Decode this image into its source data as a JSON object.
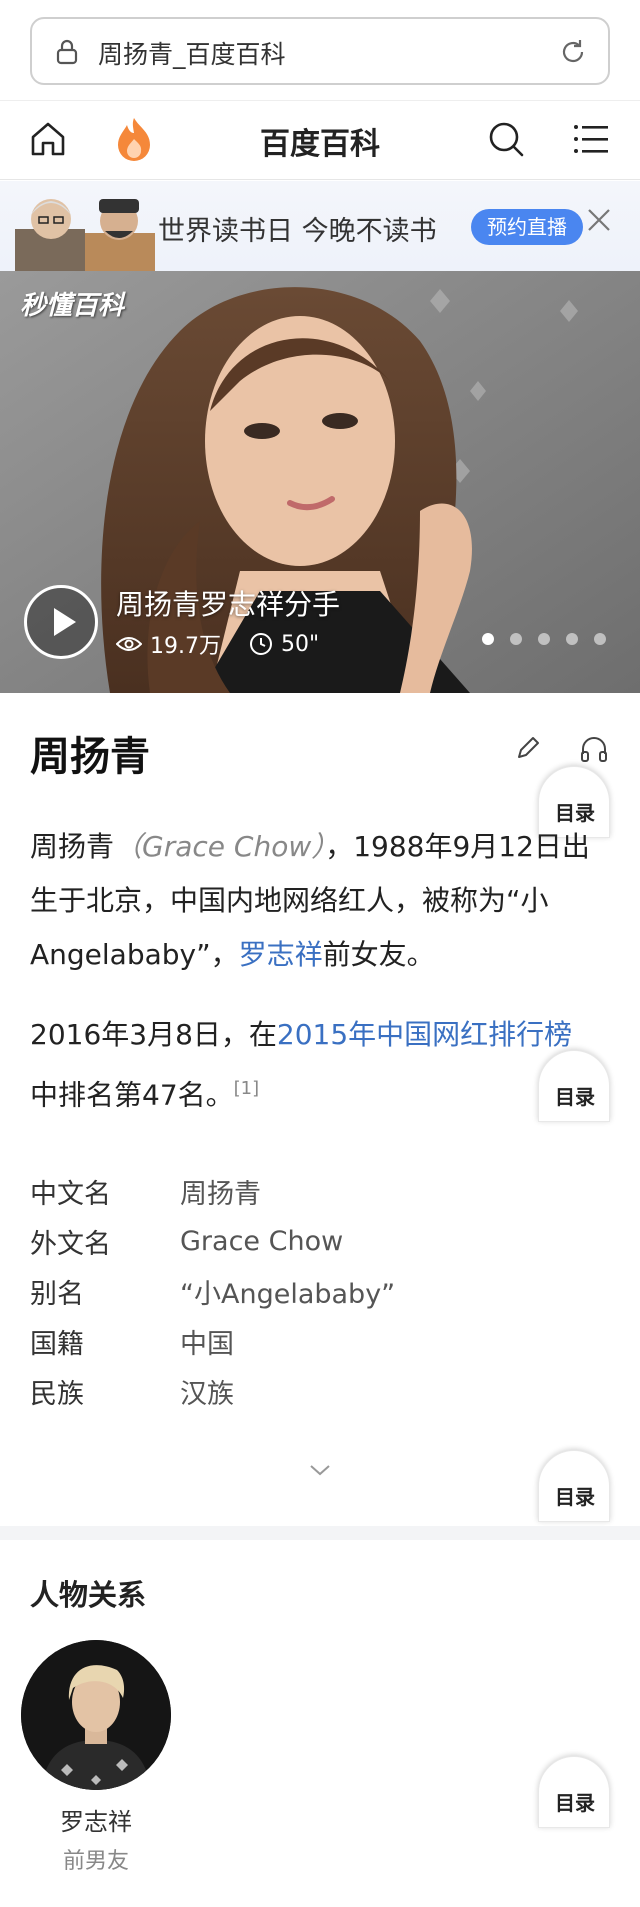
{
  "urlbar": {
    "title": "周扬青_百度百科"
  },
  "navbar": {
    "title": "百度百科"
  },
  "banner": {
    "text": "世界读书日 今晚不读书",
    "button": "预约直播"
  },
  "video": {
    "logo": "秒懂百科",
    "title": "周扬青罗志祥分手",
    "views": "19.7万",
    "duration": "50\"",
    "slide_count": 5,
    "active_slide": 0
  },
  "entry": {
    "title": "周扬青",
    "toc_label": "目录",
    "para1": {
      "name": "周扬青",
      "en": "（Grace Chow）",
      "text1": "，1988年9月12日出生于北京，中国内地网络红人，被称为“小Angelababy”，",
      "link": "罗志祥",
      "text2": "前女友。"
    },
    "para2": {
      "text1": "2016年3月8日，在",
      "link": "2015年中国网红排行榜",
      "text2": "中排名第47名。",
      "ref": "[1]"
    }
  },
  "infobox": {
    "rows": [
      {
        "key": "中文名",
        "value": "周扬青"
      },
      {
        "key": "外文名",
        "value": "Grace Chow"
      },
      {
        "key": "别名",
        "value": "“小Angelababy”"
      },
      {
        "key": "国籍",
        "value": "中国"
      },
      {
        "key": "民族",
        "value": "汉族"
      }
    ]
  },
  "relations": {
    "title": "人物关系",
    "people": [
      {
        "name": "罗志祥",
        "role": "前男友"
      }
    ]
  },
  "colors": {
    "link": "#3a70c2",
    "button": "#4a86f0",
    "fire": "#f5883a"
  }
}
